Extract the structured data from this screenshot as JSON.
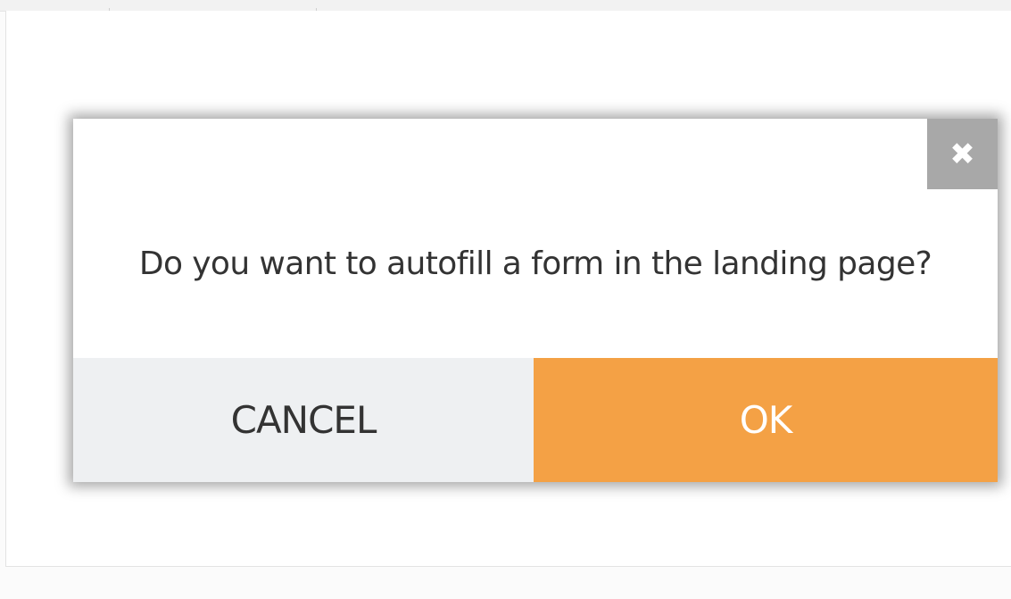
{
  "dialog": {
    "message": "Do you want to autofill a form in the landing page?",
    "close_glyph": "✖",
    "cancel_label": "CANCEL",
    "ok_label": "OK"
  },
  "colors": {
    "ok_button": "#f4a145",
    "cancel_button": "#eef0f2",
    "close_button": "#a8a8a8",
    "text": "#333333"
  },
  "icons": {
    "close": "close-icon"
  }
}
